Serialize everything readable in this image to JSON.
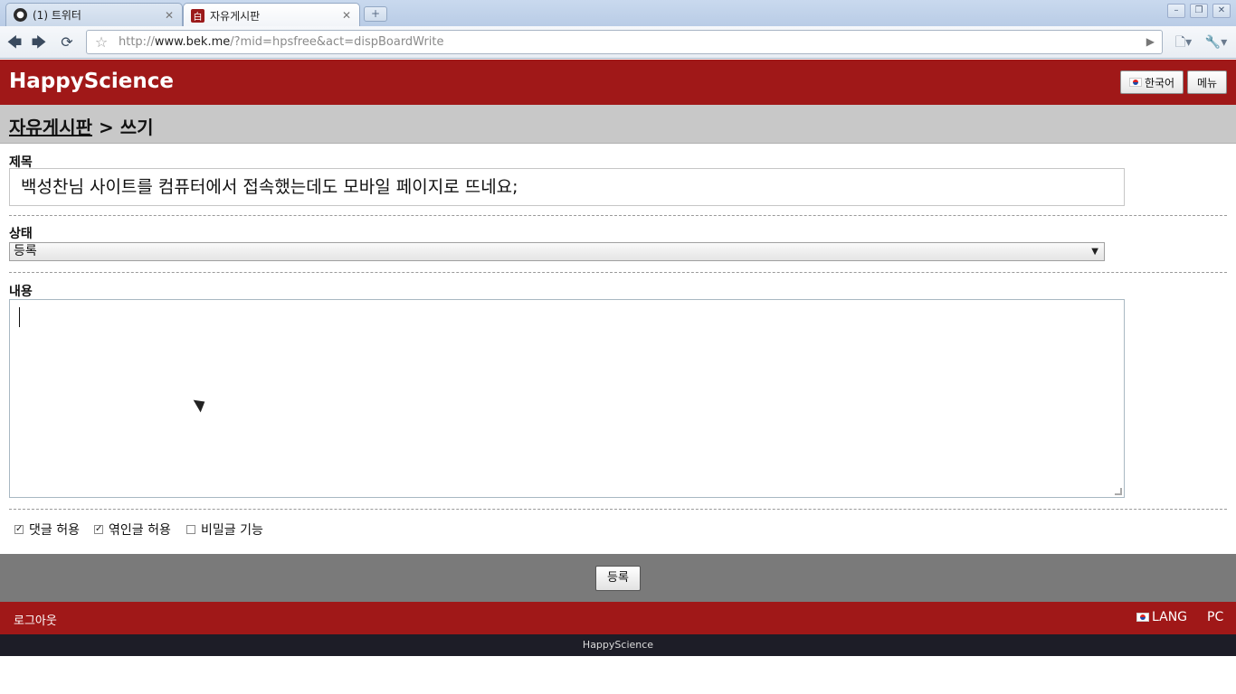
{
  "browser": {
    "tabs": [
      {
        "title": "(1) 트위터",
        "active": false,
        "favicon": "twitter-bird-icon"
      },
      {
        "title": "자유게시판",
        "active": true,
        "favicon": "board-page-icon"
      }
    ],
    "new_tab_icon": "+",
    "window_controls": {
      "minimize": "–",
      "maximize": "❐",
      "close": "✕"
    },
    "url_prefix": "http://",
    "url_host": "www.bek.me",
    "url_path": "/?mid=hpsfree&act=dispBoardWrite"
  },
  "site": {
    "title": "HappyScience",
    "language_button": "한국어",
    "menu_button": "메뉴"
  },
  "breadcrumb": {
    "board": "자유게시판",
    "separator": ">",
    "current": "쓰기"
  },
  "form": {
    "title_label": "제목",
    "title_value": "백성찬님 사이트를 컴퓨터에서 접속했는데도 모바일 페이지로 뜨네요;",
    "status_label": "상태",
    "status_value": "등록",
    "content_label": "내용",
    "content_value": "",
    "options": [
      {
        "label": "댓글 허용",
        "checked": true
      },
      {
        "label": "엮인글 허용",
        "checked": true
      },
      {
        "label": "비밀글 기능",
        "checked": false
      }
    ],
    "submit_label": "등록"
  },
  "footer": {
    "logout": "로그아웃",
    "lang": "LANG",
    "pc": "PC",
    "copyright": "HappyScience"
  },
  "colors": {
    "brand_red": "#a01818",
    "breadcrumb_gray": "#c8c8c8",
    "submit_bar_gray": "#7a7a7a",
    "copyright_dark": "#1d1d27"
  }
}
